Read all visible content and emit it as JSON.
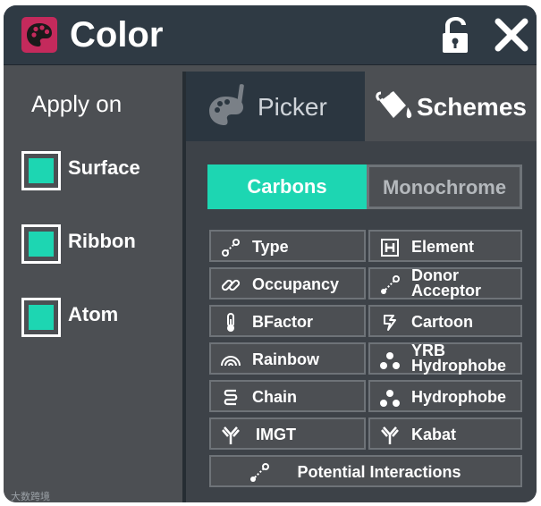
{
  "title": "Color",
  "icons": {
    "app": "palette-icon",
    "lock": "unlock-icon",
    "close": "close-icon"
  },
  "colors": {
    "accent": "#1dd6b2",
    "app_icon": "#c42a5c",
    "titlebar": "#2f3a44"
  },
  "apply_on": {
    "title": "Apply on",
    "items": [
      {
        "label": "Surface",
        "checked": true
      },
      {
        "label": "Ribbon",
        "checked": true
      },
      {
        "label": "Atom",
        "checked": true
      }
    ]
  },
  "tabs": {
    "picker": "Picker",
    "schemes": "Schemes",
    "active": "Schemes"
  },
  "mode": {
    "carbons": "Carbons",
    "monochrome": "Monochrome",
    "active": "Carbons"
  },
  "schemes": {
    "type": "Type",
    "element": "Element",
    "occupancy": "Occupancy",
    "donor_acceptor_1": "Donor",
    "donor_acceptor_2": "Acceptor",
    "bfactor": "BFactor",
    "cartoon": "Cartoon",
    "rainbow": "Rainbow",
    "yrb_1": "YRB",
    "yrb_2": "Hydrophobe",
    "chain": "Chain",
    "hydrophobe": "Hydrophobe",
    "imgt": "IMGT",
    "kabat": "Kabat",
    "potential": "Potential Interactions"
  },
  "watermark": "大数跨境"
}
